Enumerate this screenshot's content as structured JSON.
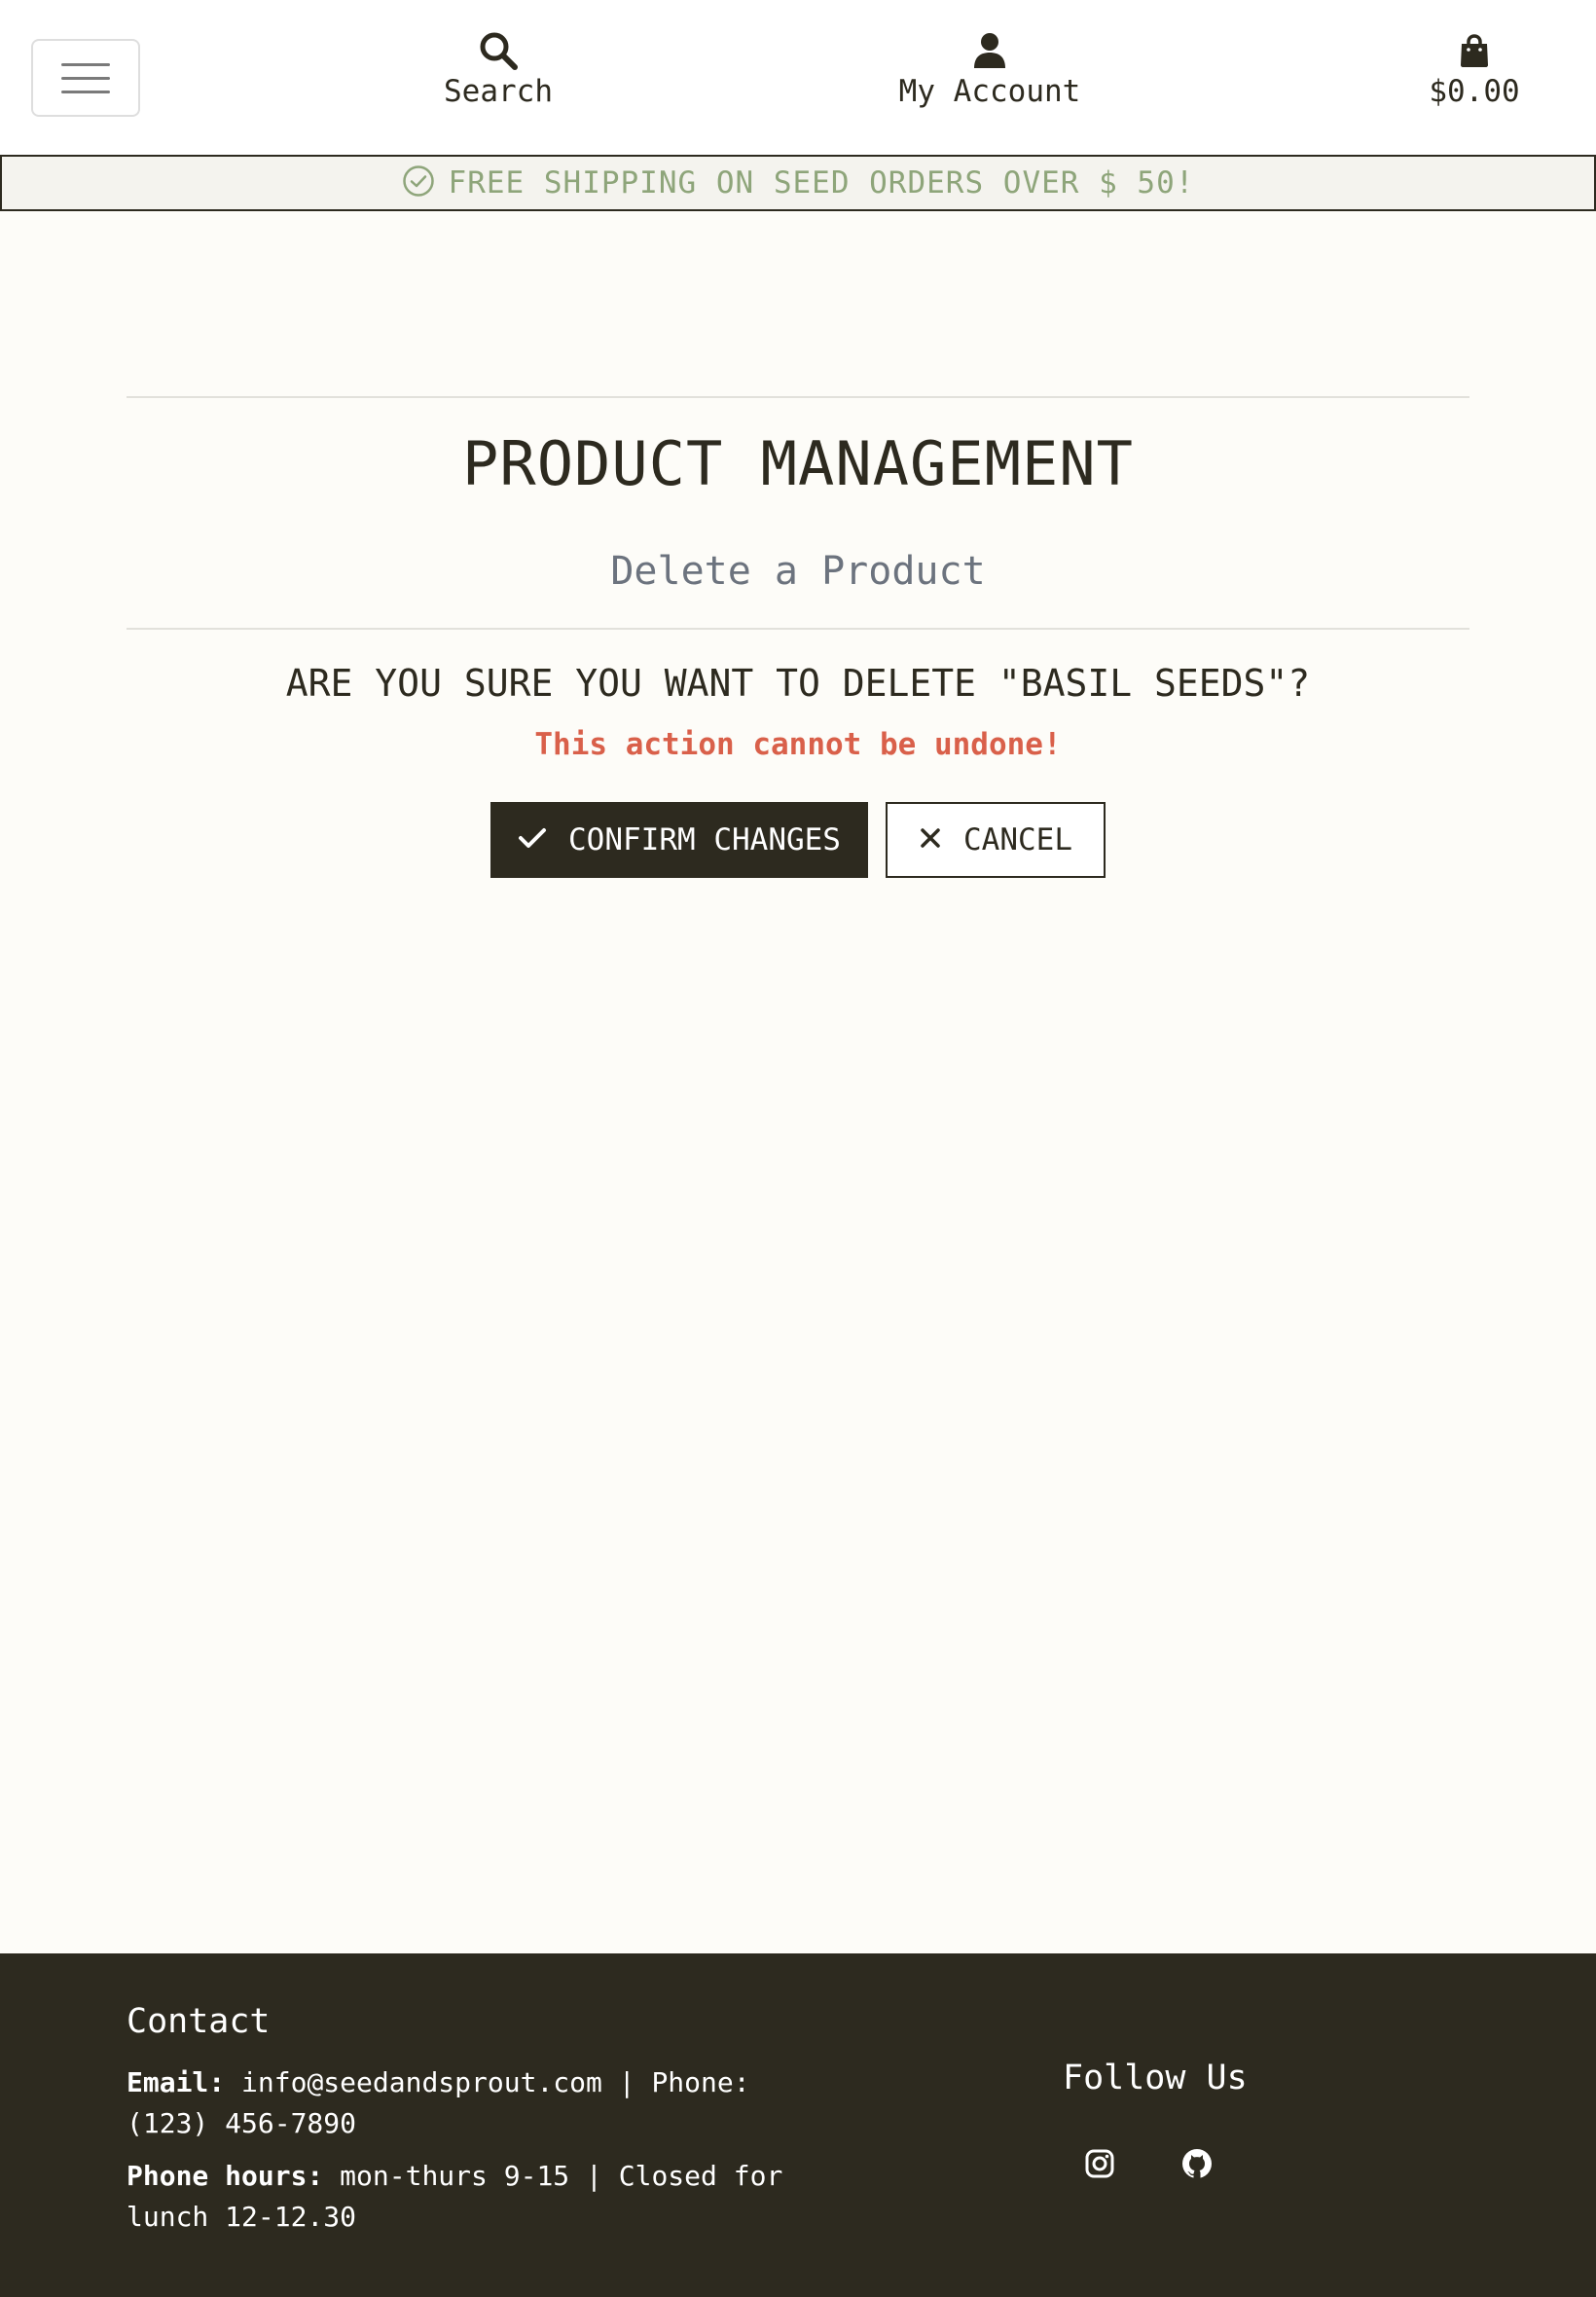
{
  "header": {
    "menu_icon": "hamburger-icon",
    "search": {
      "label": "Search",
      "icon": "search-icon"
    },
    "account": {
      "label": "My Account",
      "icon": "user-icon"
    },
    "cart": {
      "label": "$0.00",
      "icon": "shopping-bag-icon"
    }
  },
  "banner": {
    "icon": "check-circle-icon",
    "text": "FREE SHIPPING ON SEED ORDERS OVER $ 50!"
  },
  "main": {
    "title": "PRODUCT MANAGEMENT",
    "subtitle": "Delete a Product",
    "question": "ARE YOU SURE YOU WANT TO DELETE \"BASIL SEEDS\"?",
    "warning": "This action cannot be undone!",
    "confirm_label": "CONFIRM CHANGES",
    "cancel_label": "CANCEL"
  },
  "footer": {
    "contact_heading": "Contact",
    "email_label": "Email:",
    "email_text": " info@seedandsprout.com | Phone: (123) 456-7890",
    "hours_label": "Phone hours:",
    "hours_text": " mon-thurs 9-15 | Closed for lunch 12-12.30",
    "follow_heading": "Follow Us",
    "social": [
      "instagram-icon",
      "github-icon"
    ]
  },
  "colors": {
    "primary_dark": "#2d2a1f",
    "background": "#fdfcf8",
    "banner_text": "#8ea57a",
    "warning": "#d9604a",
    "subtitle": "#6c737e"
  }
}
